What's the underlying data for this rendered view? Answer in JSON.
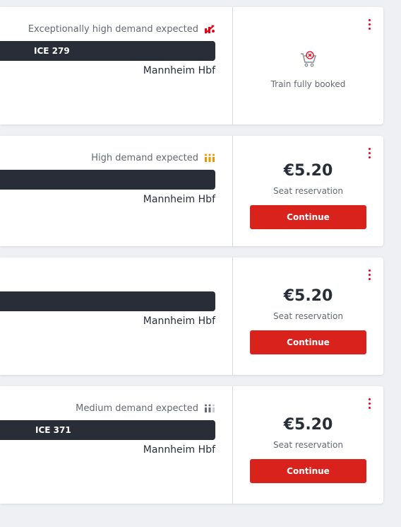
{
  "colors": {
    "accent_red": "#ec0016",
    "button_red": "#d9221b",
    "bar_dark": "#282d37",
    "demand_orange": "#f39200",
    "demand_grey": "#646973"
  },
  "offers": [
    {
      "demand_text": "Exceptionally high demand expected",
      "demand_icon": "exceptional-demand-icon",
      "train_name": "ICE 279",
      "station": "Mannheim Hbf",
      "status": "Train fully booked",
      "status_icon": "cart-unavailable-icon"
    },
    {
      "demand_text": "High demand expected",
      "demand_icon": "high-demand-icon",
      "train_name": "",
      "station": "Mannheim Hbf",
      "price": "€5.20",
      "price_label": "Seat reservation",
      "button_label": "Continue"
    },
    {
      "demand_text": "",
      "train_name": "",
      "station": "Mannheim Hbf",
      "price": "€5.20",
      "price_label": "Seat reservation",
      "button_label": "Continue"
    },
    {
      "demand_text": "Medium demand expected",
      "demand_icon": "medium-demand-icon",
      "train_name": "ICE 371",
      "station": "Mannheim Hbf",
      "price": "€5.20",
      "price_label": "Seat reservation",
      "button_label": "Continue"
    }
  ]
}
